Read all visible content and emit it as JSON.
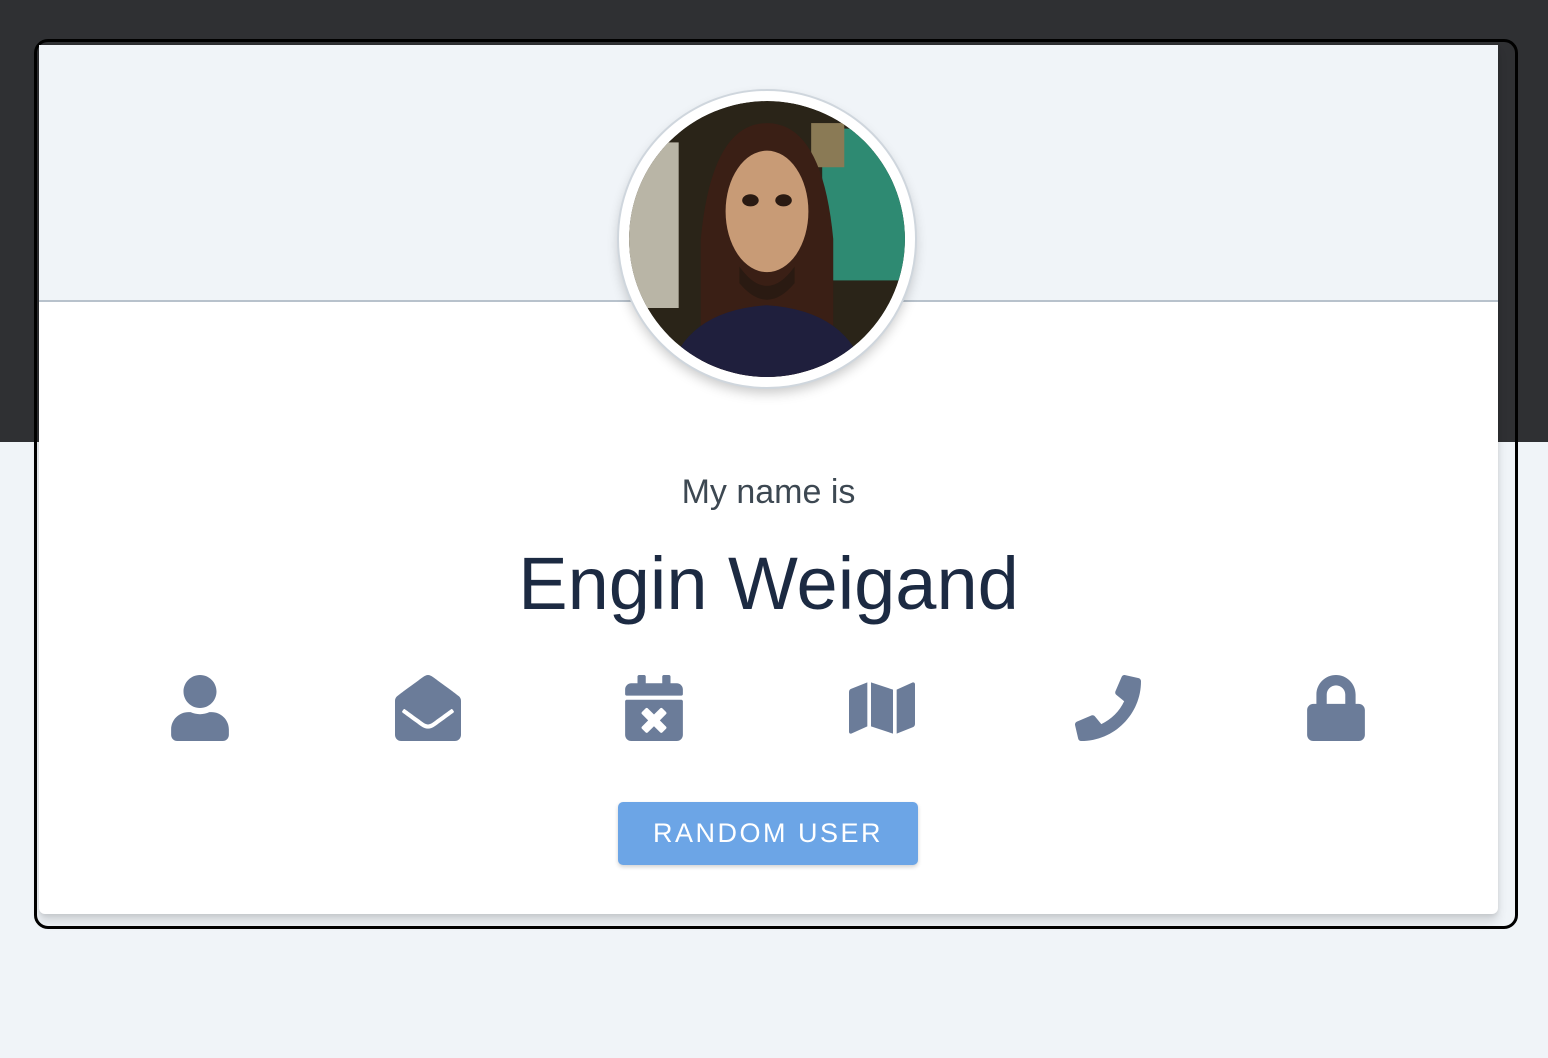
{
  "profile": {
    "intro_label": "My name is",
    "full_name": "Engin Weigand"
  },
  "icons": [
    {
      "name": "user-icon"
    },
    {
      "name": "envelope-open-icon"
    },
    {
      "name": "calendar-times-icon"
    },
    {
      "name": "map-icon"
    },
    {
      "name": "phone-icon"
    },
    {
      "name": "lock-icon"
    }
  ],
  "actions": {
    "random_user_label": "RANDOM USER"
  },
  "colors": {
    "accent": "#6ca5e6",
    "icon": "#6b7c99",
    "name_text": "#1c2a42",
    "header_bg": "#f0f4f8",
    "top_band": "#2f3033"
  }
}
